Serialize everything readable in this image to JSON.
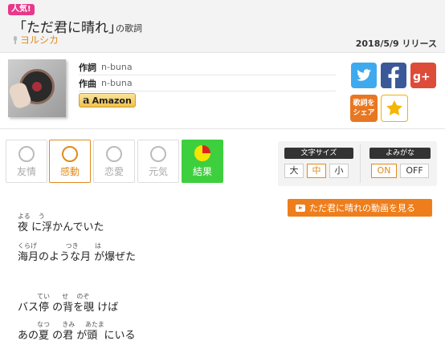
{
  "header": {
    "badge": "人気!",
    "title": "「ただ君に晴れ」",
    "title_suffix": "の歌詞",
    "artist": "ヨルシカ",
    "release": "2018/5/9 リリース"
  },
  "credits": {
    "lyricist_label": "作詞",
    "lyricist": "n-buna",
    "composer_label": "作曲",
    "composer": "n-buna"
  },
  "amazon": {
    "label": "Amazon"
  },
  "share": {
    "line1": "歌詞を",
    "line2": "シェア"
  },
  "moods": [
    {
      "label": "友情"
    },
    {
      "label": "感動"
    },
    {
      "label": "恋愛"
    },
    {
      "label": "元気"
    }
  ],
  "result": {
    "label": "結果"
  },
  "font_size": {
    "title": "文字サイズ",
    "options": [
      "大",
      "中",
      "小"
    ],
    "selected": "中"
  },
  "yomigana": {
    "title": "よみがな",
    "options": [
      "ON",
      "OFF"
    ],
    "selected": "ON"
  },
  "video_button": "ただ君に晴れの動画を見る",
  "lyrics": [
    {
      "text": "夜 に浮かんでいた",
      "ruby": "よる    う"
    },
    {
      "text": "海月のような月 が爆ぜた",
      "ruby": "くらげ              つき        は"
    },
    {
      "text": "バス停 の背を覗 けば",
      "ruby": "てい      せ    のぞ"
    },
    {
      "text": "あの夏 の君 が頭  にいる",
      "ruby": "なつ      きみ     あたま"
    }
  ],
  "colors": {
    "accent": "#e08a1e",
    "badge": "#e8388a",
    "result": "#3ecf3e",
    "video": "#ee7e1c"
  }
}
